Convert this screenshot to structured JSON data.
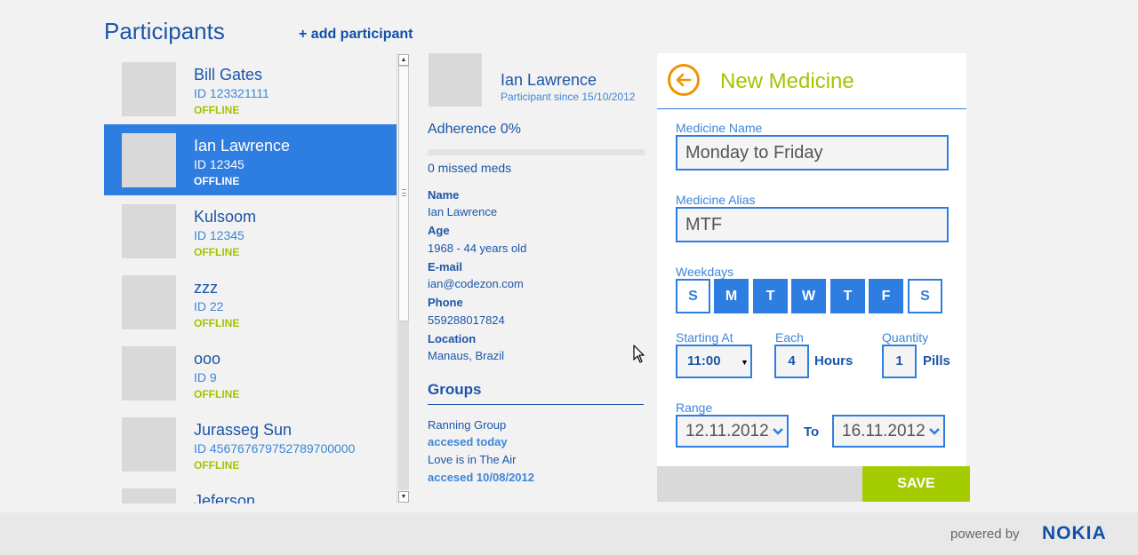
{
  "header": {
    "title": "Participants",
    "add_link": "+ add participant"
  },
  "participants": [
    {
      "name": "Bill Gates",
      "id": "ID 123321111",
      "status": "OFFLINE"
    },
    {
      "name": "Ian Lawrence",
      "id": "ID 12345",
      "status": "OFFLINE",
      "selected": true
    },
    {
      "name": "Kulsoom",
      "id": "ID 12345",
      "status": "OFFLINE"
    },
    {
      "name": "zzz",
      "id": "ID 22",
      "status": "OFFLINE"
    },
    {
      "name": "ooo",
      "id": "ID 9",
      "status": "OFFLINE"
    },
    {
      "name": "Jurasseg Sun",
      "id": "ID 456767679752789700000",
      "status": "OFFLINE"
    },
    {
      "name": "Jeferson",
      "id": "",
      "status": ""
    }
  ],
  "detail": {
    "name": "Ian Lawrence",
    "since": "Participant since 15/10/2012",
    "adherence": "Adherence 0%",
    "adherence_value": 0,
    "missed": "0 missed meds",
    "fields": [
      {
        "label": "Name",
        "value": "Ian Lawrence"
      },
      {
        "label": "Age",
        "value": "1968 - 44 years old"
      },
      {
        "label": "E-mail",
        "value": "ian@codezon.com"
      },
      {
        "label": "Phone",
        "value": "559288017824"
      },
      {
        "label": "Location",
        "value": "Manaus, Brazil"
      }
    ],
    "groups_title": "Groups",
    "groups": [
      {
        "name": "Ranning Group",
        "accessed": "accesed today"
      },
      {
        "name": "Love is in The Air",
        "accessed": "accesed 10/08/2012"
      }
    ]
  },
  "form": {
    "title": "New Medicine",
    "medicine_name_label": "Medicine Name",
    "medicine_name_value": "Monday to Friday",
    "medicine_alias_label": "Medicine Alias",
    "medicine_alias_value": "MTF",
    "weekdays_label": "Weekdays",
    "weekdays": [
      {
        "letter": "S",
        "on": false
      },
      {
        "letter": "M",
        "on": true
      },
      {
        "letter": "T",
        "on": true
      },
      {
        "letter": "W",
        "on": true
      },
      {
        "letter": "T",
        "on": true
      },
      {
        "letter": "F",
        "on": true
      },
      {
        "letter": "S",
        "on": false
      }
    ],
    "starting_label": "Starting At",
    "starting_value": "11:00",
    "each_label": "Each",
    "each_value": "4",
    "each_unit": "Hours",
    "quantity_label": "Quantity",
    "quantity_value": "1",
    "quantity_unit": "Pills",
    "range_label": "Range",
    "range_from": "12.11.2012",
    "range_to_label": "To",
    "range_to": "16.11.2012",
    "save_label": "SAVE"
  },
  "footer": {
    "powered_by": "powered by",
    "brand": "NOKIA"
  },
  "colors": {
    "accent_blue": "#2e7de0",
    "title_green": "#a4c400",
    "save_green": "#a4cc00",
    "back_orange": "#f39200",
    "offline_green": "#a4c400"
  }
}
